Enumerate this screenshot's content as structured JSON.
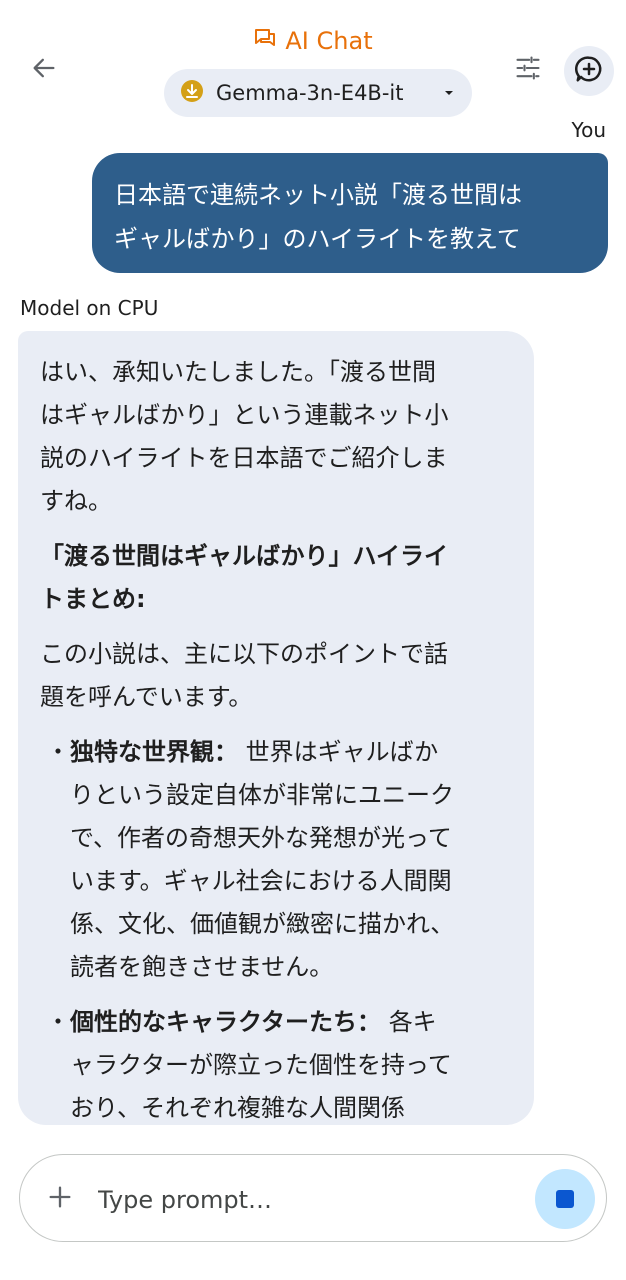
{
  "header": {
    "app_title": "AI Chat",
    "model_name": "Gemma-3n-E4B-it",
    "icons": {
      "back": "arrow-back-icon",
      "title": "chat-bubbles-icon",
      "download": "download-icon",
      "dropdown": "dropdown-arrow-icon",
      "tune": "tune-sliders-icon",
      "new_chat": "add-comment-icon"
    },
    "accent_color": "#e8710a"
  },
  "conversation": {
    "user_label": "You",
    "user_message_lines": [
      "日本語で連続ネット小説「渡る世間は",
      "ギャルばかり」のハイライトを教えて"
    ],
    "model_label": "Model on CPU",
    "model_lines": {
      "intro": [
        "はい、承知いたしました。「渡る世間",
        "はギャルばかり」という連載ネット小",
        "説のハイライトを日本語でご紹介しま",
        "すね。"
      ],
      "heading": [
        "「渡る世間はギャルばかり」ハイライ",
        "トまとめ:"
      ],
      "para": [
        "この小説は、主に以下のポイントで話",
        "題を呼んでいます。"
      ],
      "b1_title": "独特な世界観：",
      "b1": [
        "世界はギャルばか",
        "りという設定自体が非常にユニーク",
        "で、作者の奇想天外な発想が光って",
        "います。ギャル社会における人間関",
        "係、文化、価値観が緻密に描かれ、",
        "読者を飽きさせません。"
      ],
      "b2_title": "個性的なキャラクターたち：",
      "b2": [
        "各キ",
        "ャラクターが際立った個性を持って",
        "おり、それぞれ複雑な人間関係"
      ]
    },
    "bullet": "・",
    "user_bubble_color": "#2e5e8b",
    "model_bubble_color": "#e9edf5"
  },
  "composer": {
    "placeholder": "Type prompt…",
    "icons": {
      "add": "plus-icon",
      "stop": "stop-icon"
    },
    "stop_button_color": "#c2e7ff"
  }
}
